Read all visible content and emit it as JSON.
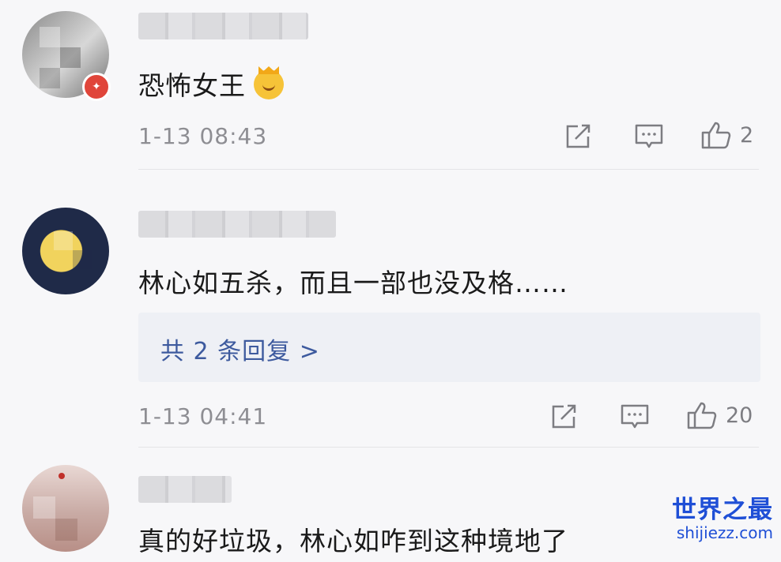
{
  "comments": [
    {
      "text": "恐怖女王",
      "emoji": "princess-emoji",
      "time": "1-13 08:43",
      "likes": "2"
    },
    {
      "text": "林心如五杀，而且一部也没及格……",
      "reply_link": "共 2 条回复 >",
      "time": "1-13 04:41",
      "likes": "20"
    },
    {
      "text": "真的好垃圾，林心如咋到这种境地了"
    }
  ],
  "watermark": {
    "title": "世界之最",
    "url": "shijiezz.com"
  },
  "colors": {
    "background": "#f7f7f9",
    "link_blue": "#3d5a9e",
    "meta_gray": "#8e8e93",
    "badge_red": "#e0453a"
  }
}
